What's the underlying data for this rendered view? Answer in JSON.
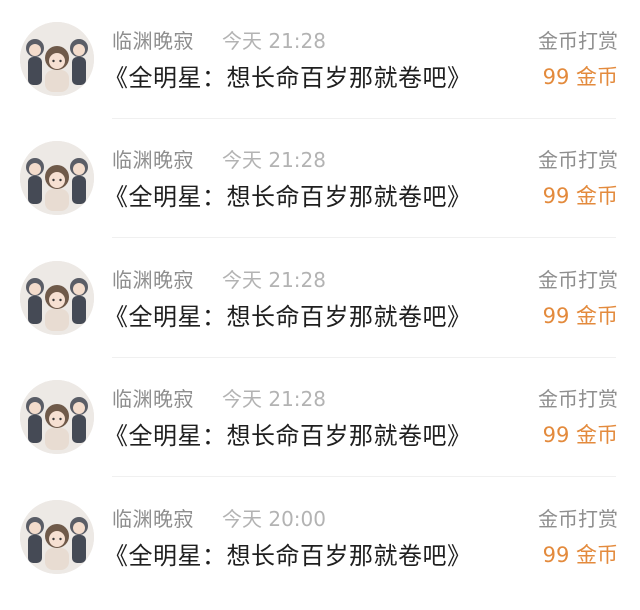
{
  "items": [
    {
      "user": "临渊晚寂",
      "time": "今天 21:28",
      "title": "《全明星：想长命百岁那就卷吧》",
      "reward_label": "金币打赏",
      "reward_amount": "99 金币"
    },
    {
      "user": "临渊晚寂",
      "time": "今天 21:28",
      "title": "《全明星：想长命百岁那就卷吧》",
      "reward_label": "金币打赏",
      "reward_amount": "99 金币"
    },
    {
      "user": "临渊晚寂",
      "time": "今天 21:28",
      "title": "《全明星：想长命百岁那就卷吧》",
      "reward_label": "金币打赏",
      "reward_amount": "99 金币"
    },
    {
      "user": "临渊晚寂",
      "time": "今天 21:28",
      "title": "《全明星：想长命百岁那就卷吧》",
      "reward_label": "金币打赏",
      "reward_amount": "99 金币"
    },
    {
      "user": "临渊晚寂",
      "time": "今天 20:00",
      "title": "《全明星：想长命百岁那就卷吧》",
      "reward_label": "金币打赏",
      "reward_amount": "99 金币"
    }
  ],
  "colors": {
    "username": "#8e8e8e",
    "time": "#b3b3b3",
    "title": "#1f1f1f",
    "reward_amount": "#e38a3c"
  },
  "icons": {
    "avatar": "three-character-illustration-avatar"
  }
}
